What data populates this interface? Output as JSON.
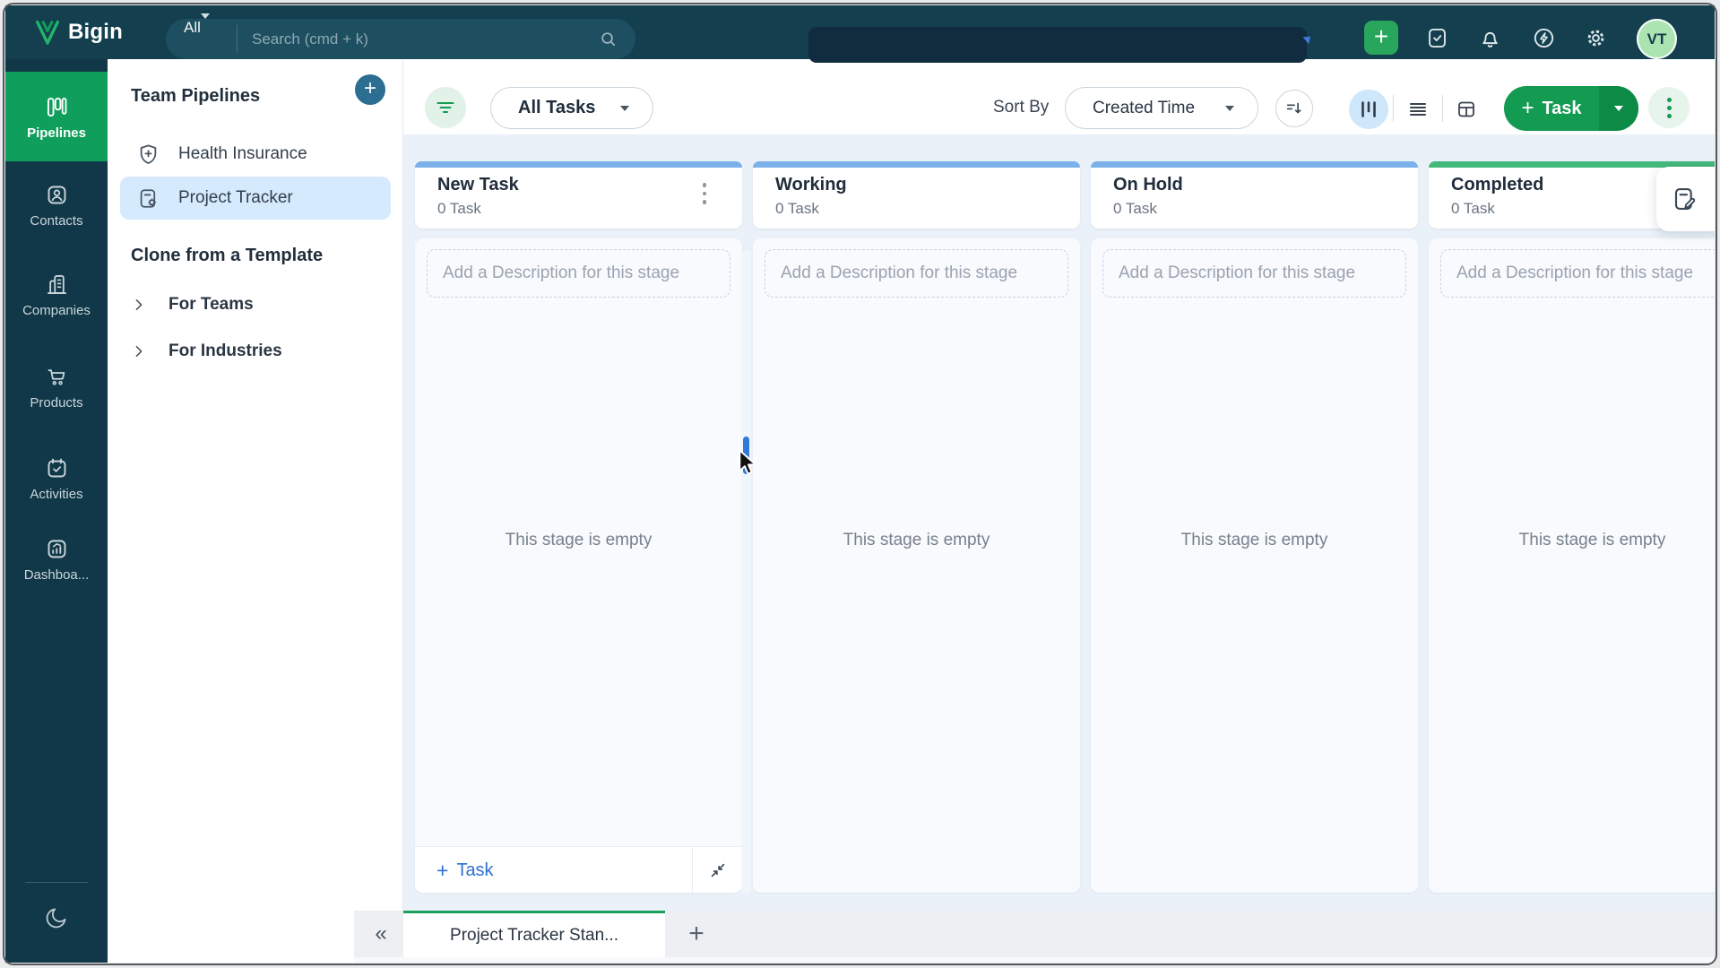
{
  "header": {
    "brand": "Bigin",
    "search_scope": "All",
    "search_placeholder": "Search (cmd + k)",
    "avatar_initials": "VT"
  },
  "glyphs": {
    "plus": "+",
    "double_chevron_left": "«"
  },
  "nav": {
    "items": [
      {
        "label": "Pipelines",
        "active": true
      },
      {
        "label": "Contacts"
      },
      {
        "label": "Companies"
      },
      {
        "label": "Products"
      },
      {
        "label": "Activities"
      },
      {
        "label": "Dashboa..."
      }
    ]
  },
  "sidebar": {
    "title": "Team Pipelines",
    "pipelines": [
      {
        "label": "Health Insurance",
        "selected": false
      },
      {
        "label": "Project Tracker",
        "selected": true
      }
    ],
    "templates_title": "Clone from a Template",
    "templates": [
      {
        "label": "For Teams"
      },
      {
        "label": "For Industries"
      }
    ]
  },
  "toolbar": {
    "task_filter": "All Tasks",
    "sort_by_label": "Sort By",
    "sort_value": "Created Time",
    "add_task_label": "Task"
  },
  "board": {
    "columns": [
      {
        "title": "New Task",
        "count": "0 Task",
        "bar_color": "#7cb0e8"
      },
      {
        "title": "Working",
        "count": "0 Task",
        "bar_color": "#7cb0e8"
      },
      {
        "title": "On Hold",
        "count": "0 Task",
        "bar_color": "#7cb0e8"
      },
      {
        "title": "Completed",
        "count": "0 Task",
        "bar_color": "#43ba7b"
      }
    ],
    "description_placeholder": "Add a Description for this stage",
    "empty_text": "This stage is empty",
    "footer_add_task_label": "Task"
  },
  "bottom_bar": {
    "active_tab": "Project Tracker Stan..."
  },
  "colors": {
    "header_bg": "#133f4e",
    "rail_bg": "#113848",
    "brand_green": "#109e5c",
    "task_button_green": "#149b52",
    "accent_blue": "#2b6fd6",
    "selected_item_bg": "#d5eafd",
    "column_bar_blue": "#7cb0e8",
    "column_bar_green": "#43ba7b",
    "board_bg": "#eaf1f8",
    "avatar_bg": "#ace4b1",
    "scroll_thumb_blue": "#2f7cd8"
  }
}
